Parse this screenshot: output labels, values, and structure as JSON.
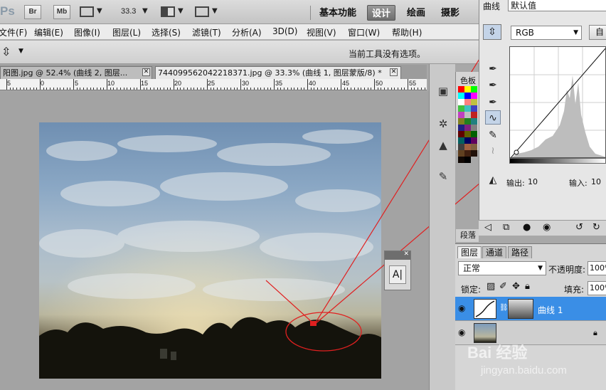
{
  "app": {
    "logo": "Ps",
    "bridge_label": "Br",
    "minibridge_label": "Mb",
    "zoom": "33.3",
    "workspaces": [
      "基本功能",
      "设计",
      "绘画",
      "摄影"
    ],
    "active_workspace": "设计"
  },
  "menu": [
    "文件(F)",
    "编辑(E)",
    "图像(I)",
    "图层(L)",
    "选择(S)",
    "滤镜(T)",
    "分析(A)",
    "3D(D)",
    "视图(V)",
    "窗口(W)",
    "帮助(H)"
  ],
  "options_bar": {
    "message": "当前工具没有选项。"
  },
  "tabs": [
    {
      "title": "阳图.jpg @ 52.4% (曲线 2, 图层...",
      "active": false
    },
    {
      "title": "744099562042218371.jpg @ 33.3% (曲线 1, 图层蒙版/8) *",
      "active": true
    }
  ],
  "ruler": {
    "labels": [
      "5",
      "0",
      "5",
      "10",
      "15",
      "20",
      "25",
      "30",
      "35",
      "40",
      "45",
      "50",
      "55"
    ]
  },
  "swatches": {
    "title": "色板",
    "colors": [
      "#ff0000",
      "#ffff00",
      "#00ff00",
      "#00ffff",
      "#0000ff",
      "#ff00ff",
      "#ffffff",
      "#ff8080",
      "#c0c040",
      "#40c040",
      "#40c0c0",
      "#4040c0",
      "#c040c0",
      "#c0c0c0",
      "#c02020",
      "#808020",
      "#208020",
      "#208080",
      "#202080",
      "#802080",
      "#808080",
      "#600000",
      "#606000",
      "#006000",
      "#006060",
      "#000060",
      "#600060",
      "#404040",
      "#a06040",
      "#806040",
      "#604020",
      "#402010",
      "#201008",
      "#100804",
      "#000000"
    ]
  },
  "curves": {
    "title": "曲线",
    "preset": "默认值",
    "channel": "RGB",
    "auto_label": "自",
    "output_label": "输出:",
    "output_value": "10",
    "input_label": "输入:",
    "input_value": "10"
  },
  "layers": {
    "tabs": [
      "图层",
      "通道",
      "路径"
    ],
    "blend_mode": "正常",
    "opacity_label": "不透明度:",
    "opacity_value": "100%",
    "lock_label": "锁定:",
    "fill_label": "填充:",
    "fill_value": "100%",
    "rows": [
      {
        "name": "曲线 1",
        "selected": true
      },
      {
        "name": "",
        "selected": false
      }
    ]
  },
  "paragraph_tab": "段落",
  "char_icon": "A|",
  "watermark": {
    "brand": "Bai 经验",
    "url": "jingyan.baidu.com"
  },
  "colors": {
    "selection_blue": "#3a8ee6",
    "annotation_red": "#e02020"
  }
}
